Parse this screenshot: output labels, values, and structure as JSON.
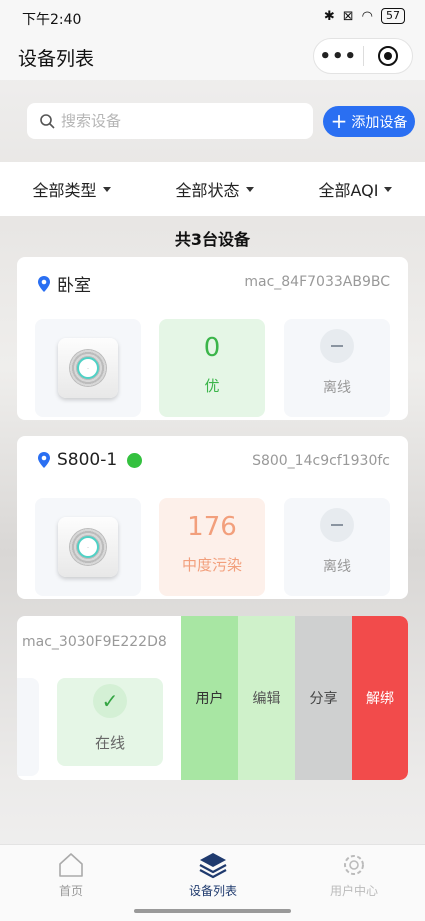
{
  "status_bar": {
    "time": "下午2:40",
    "battery": "57"
  },
  "header": {
    "title": "设备列表"
  },
  "search": {
    "placeholder": "搜索设备",
    "add_label": "添加设备"
  },
  "filters": [
    "全部类型",
    "全部状态",
    "全部AQI"
  ],
  "summary": "共3台设备",
  "devices": [
    {
      "name": "卧室",
      "mac": "mac_84F7033AB9BC",
      "aqi": "0",
      "aqi_level": "优",
      "status": "离线"
    },
    {
      "name": "S800-1",
      "mac": "S800_14c9cf1930fc",
      "aqi": "176",
      "aqi_level": "中度污染",
      "status": "离线"
    }
  ],
  "swiped_device": {
    "mac": "mac_3030F9E222D8",
    "status": "在线",
    "actions": {
      "user": "用户",
      "edit": "编辑",
      "share": "分享",
      "unbind": "解绑"
    }
  },
  "tabbar": {
    "home": "首页",
    "list": "设备列表",
    "me": "用户中心"
  },
  "colors": {
    "accent": "#2a6ff2",
    "online": "#34c13f",
    "good": "#3bb54a",
    "moderate": "#f29f7c",
    "unbind": "#f24b4b",
    "tab_active": "#1f3a6e"
  }
}
